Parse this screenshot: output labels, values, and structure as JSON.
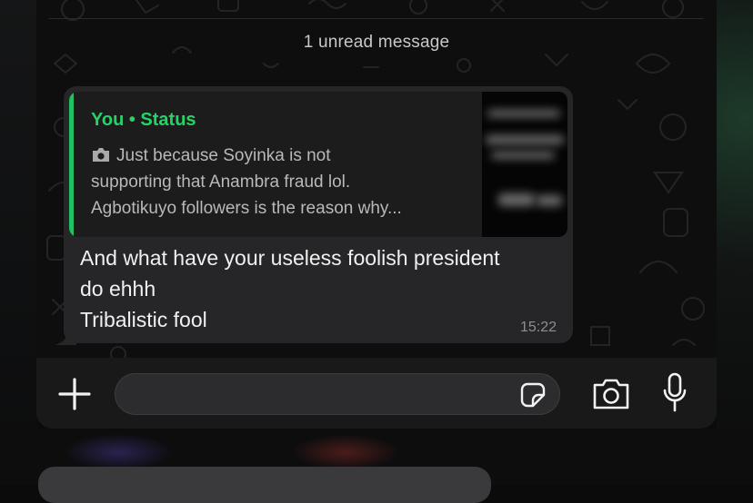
{
  "chat": {
    "unread_banner": "1 unread message"
  },
  "message": {
    "quote": {
      "author": "You • Status",
      "lines": [
        "Just because Soyinka is not",
        "supporting that Anambra fraud lol.",
        "Agbotikuyo followers is the reason why..."
      ]
    },
    "text_lines": [
      "And what have your useless foolish president",
      "do ehhh",
      "Tribalistic fool"
    ],
    "time": "15:22"
  },
  "input": {
    "placeholder": ""
  },
  "icons": {
    "attach": "plus-icon",
    "sticker": "sticker-icon",
    "camera": "camera-icon",
    "mic": "microphone-icon",
    "quote_media": "camera-icon"
  },
  "colors": {
    "accent": "#25d366",
    "bubble": "#262628",
    "quote_bg": "#1c1c1d",
    "background": "#0e0e0f",
    "text": "#f0f0f0",
    "secondary_text": "#b9b9b9"
  }
}
